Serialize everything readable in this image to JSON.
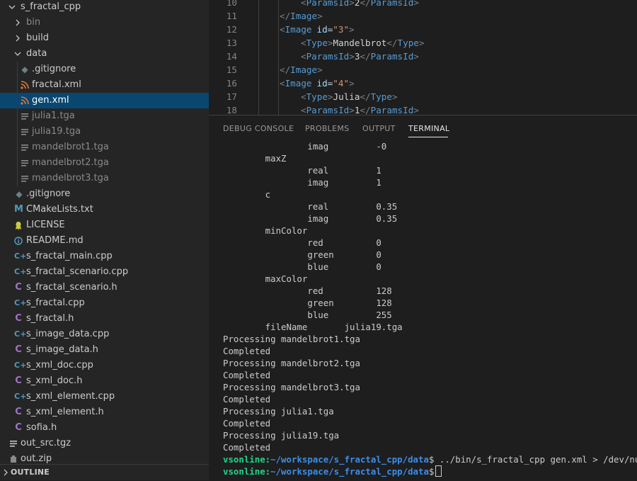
{
  "explorer": {
    "root": "s_fractal_cpp",
    "folders": {
      "bin": "bin",
      "build": "build",
      "data": "data"
    },
    "data_files": [
      ".gitignore",
      "fractal.xml",
      "gen.xml",
      "julia1.tga",
      "julia19.tga",
      "mandelbrot1.tga",
      "mandelbrot2.tga",
      "mandelbrot3.tga"
    ],
    "root_files": [
      ".gitignore",
      "CMakeLists.txt",
      "LICENSE",
      "README.md",
      "s_fractal_main.cpp",
      "s_fractal_scenario.cpp",
      "s_fractal_scenario.h",
      "s_fractal.cpp",
      "s_fractal.h",
      "s_image_data.cpp",
      "s_image_data.h",
      "s_xml_doc.cpp",
      "s_xml_doc.h",
      "s_xml_element.cpp",
      "s_xml_element.h",
      "sofia.h",
      "out_src.tgz",
      "out.zip"
    ],
    "outline_label": "OUTLINE"
  },
  "editor": {
    "line_numbers": [
      "10",
      "11",
      "12",
      "13",
      "14",
      "15",
      "16",
      "17",
      "18"
    ],
    "lines": [
      {
        "open": "<",
        "tag": "ParamsId",
        "close": ">",
        "text": "2",
        "end_open": "</",
        "end_tag": "ParamsId",
        "end_close": ">"
      },
      {
        "end_open": "</",
        "end_tag": "Image",
        "end_close": ">"
      },
      {
        "open": "<",
        "tag": "Image",
        "attr": "id",
        "eq": "=",
        "val": "\"3\"",
        "close": ">"
      },
      {
        "open": "<",
        "tag": "Type",
        "close": ">",
        "text": "Mandelbrot",
        "end_open": "</",
        "end_tag": "Type",
        "end_close": ">"
      },
      {
        "open": "<",
        "tag": "ParamsId",
        "close": ">",
        "text": "3",
        "end_open": "</",
        "end_tag": "ParamsId",
        "end_close": ">"
      },
      {
        "end_open": "</",
        "end_tag": "Image",
        "end_close": ">"
      },
      {
        "open": "<",
        "tag": "Image",
        "attr": "id",
        "eq": "=",
        "val": "\"4\"",
        "close": ">"
      },
      {
        "open": "<",
        "tag": "Type",
        "close": ">",
        "text": "Julia",
        "end_open": "</",
        "end_tag": "Type",
        "end_close": ">"
      },
      {
        "open": "<",
        "tag": "ParamsId",
        "close": ">",
        "text": "1",
        "end_open": "</",
        "end_tag": "ParamsId",
        "end_close": ">"
      }
    ]
  },
  "panel": {
    "tabs": [
      "DEBUG CONSOLE",
      "PROBLEMS",
      "OUTPUT",
      "TERMINAL"
    ],
    "active_tab": "TERMINAL"
  },
  "terminal": {
    "output_lines": [
      "                imag         -0",
      "        maxZ",
      "                real         1",
      "                imag         1",
      "        c",
      "                real         0.35",
      "                imag         0.35",
      "        minColor",
      "                red          0",
      "                green        0",
      "                blue         0",
      "        maxColor",
      "                red          128",
      "                green        128",
      "                blue         255",
      "        fileName       julia19.tga",
      "Processing mandelbrot1.tga",
      "Completed",
      "Processing mandelbrot2.tga",
      "Completed",
      "Processing mandelbrot3.tga",
      "Completed",
      "Processing julia1.tga",
      "Completed",
      "Processing julia19.tga",
      "Completed"
    ],
    "prompt_user": "vsonline:",
    "prompt_path": "~/workspace/s_fractal_cpp/data",
    "prompt_symbol": "$",
    "command": " ../bin/s_fractal_cpp gen.xml > /dev/null",
    "current_input": " "
  },
  "colors": {
    "selection": "#094771",
    "prompt_user": "#23d18b",
    "prompt_path": "#3b8eea",
    "xml_file_icon": "#e37933",
    "cpp_icon": "#519aba",
    "h_icon": "#a074c4"
  }
}
